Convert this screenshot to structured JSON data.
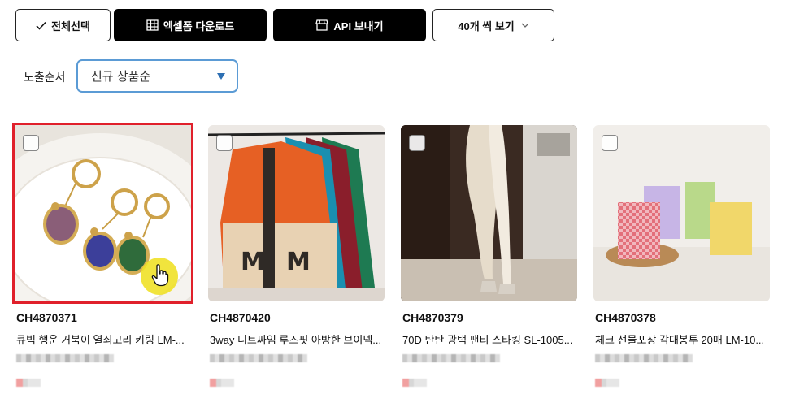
{
  "toolbar": {
    "select_all_label": "전체선택",
    "excel_download_label": "엑셀폼 다운로드",
    "api_send_label": "API 보내기",
    "per_page_label": "40개 씩 보기"
  },
  "sort": {
    "label": "노출순서",
    "selected": "신규 상품순"
  },
  "colors": {
    "selected_outline": "#e0202b",
    "select_border": "#5b9bd5",
    "dark_button": "#000000"
  },
  "products": [
    {
      "code": "CH4870371",
      "name": "큐빅 행운 거북이 열쇠고리 키링 LM-...",
      "image": "turtle-keyring-image",
      "selected": true
    },
    {
      "code": "CH4870420",
      "name": "3way 니트짜임 루즈핏 아방한 브이넥...",
      "image": "cardigans-image",
      "selected": false
    },
    {
      "code": "CH4870379",
      "name": "70D 탄탄 광택 팬티 스타킹 SL-1005...",
      "image": "stockings-image",
      "selected": false
    },
    {
      "code": "CH4870378",
      "name": "체크 선물포장 각대봉투 20매 LM-10...",
      "image": "gift-bags-image",
      "selected": false
    }
  ]
}
